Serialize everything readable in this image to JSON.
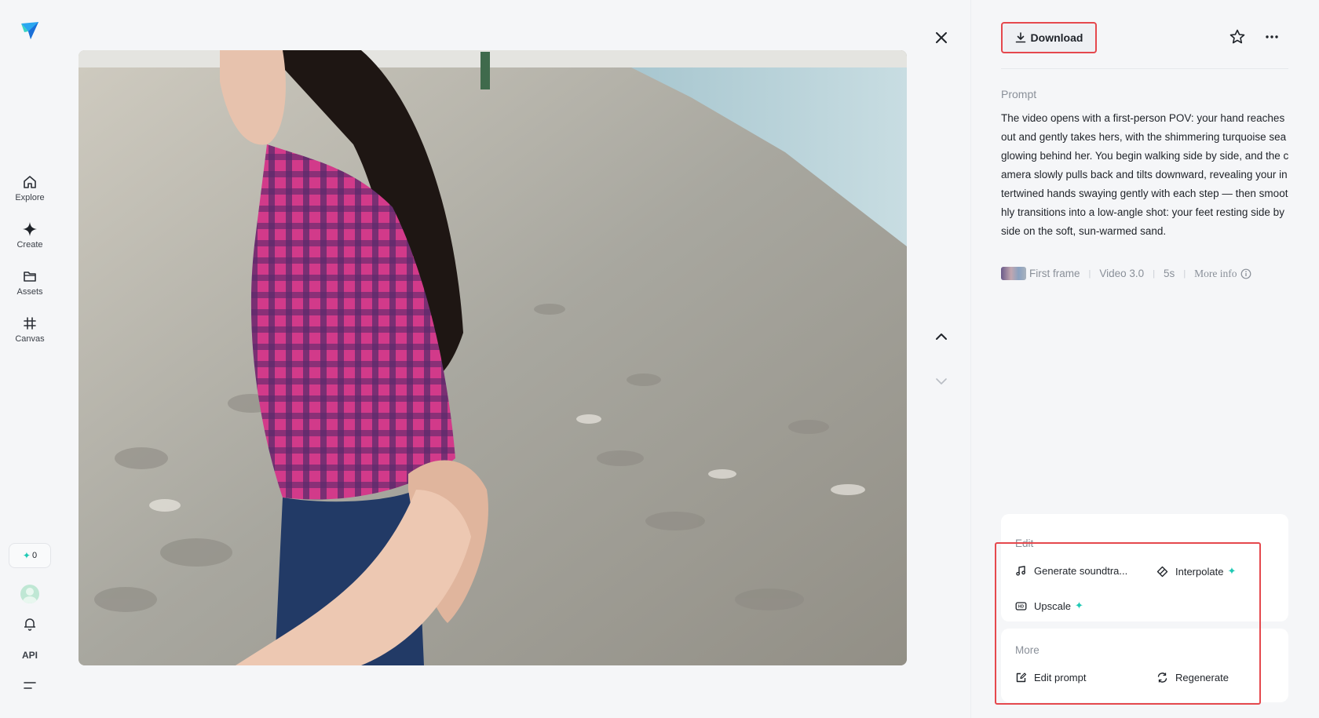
{
  "sidebar": {
    "items": [
      {
        "label": "Explore",
        "icon": "home-icon"
      },
      {
        "label": "Create",
        "icon": "diamond-icon"
      },
      {
        "label": "Assets",
        "icon": "folder-icon"
      },
      {
        "label": "Canvas",
        "icon": "canvas-icon"
      }
    ],
    "credits": "0",
    "api_label": "API"
  },
  "header": {
    "download_label": "Download"
  },
  "prompt": {
    "label": "Prompt",
    "text": "The video opens with a first-person POV: your hand reaches out and gently takes hers, with the shimmering turquoise sea glowing behind her. You begin walking side by side, and the camera slowly pulls back and tilts downward, revealing your intertwined hands swaying gently with each step — then smoothly transitions into a low-angle shot: your feet resting side by side on the soft, sun-warmed sand."
  },
  "meta": {
    "first_frame": "First frame",
    "model": "Video 3.0",
    "duration": "5s",
    "more_info": "More info"
  },
  "edit": {
    "title": "Edit",
    "generate_soundtrack": "Generate soundtra...",
    "interpolate": "Interpolate",
    "upscale": "Upscale"
  },
  "more": {
    "title": "More",
    "edit_prompt": "Edit prompt",
    "regenerate": "Regenerate"
  },
  "colors": {
    "accent_spark": "#1fc9b4",
    "highlight_red": "#e5484d",
    "background": "#f5f6f8"
  }
}
